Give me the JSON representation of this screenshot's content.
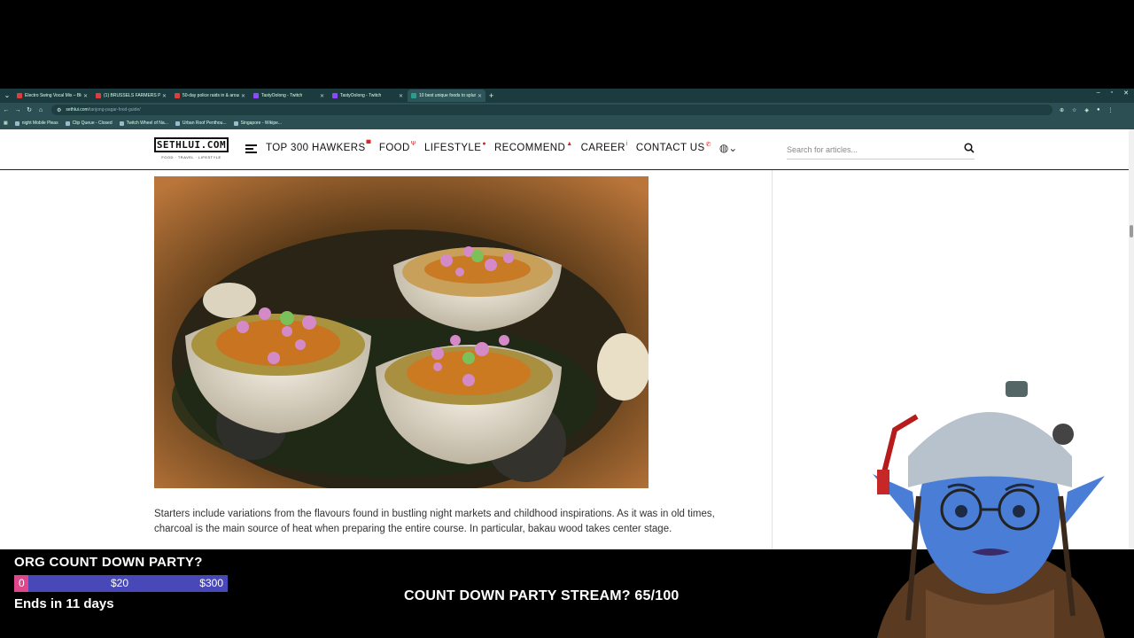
{
  "browser": {
    "tabs": [
      {
        "title": "Electro Swing Vocal Mix – Bloo",
        "fav": "#e23b3b"
      },
      {
        "title": "(1) BRUSSELS FARMERS PROTE",
        "fav": "#e23b3b"
      },
      {
        "title": "50-day police raids in & aroun",
        "fav": "#e23b3b"
      },
      {
        "title": "TastyOolong - Twitch",
        "fav": "#9146ff"
      },
      {
        "title": "TastyOolong - Twitch",
        "fav": "#9146ff"
      },
      {
        "title": "10 best unique foods to splurg",
        "fav": "#2a9d8f"
      }
    ],
    "url_host": "sethlui.com",
    "url_path": "/tanjong-pagar-food-guide/",
    "bookmarks": [
      "night Mobile Pleas",
      "Clip Queue - Closed",
      "Twitch Wheel of Na...",
      "Urban Roof Penthou...",
      "Singapore - Wikipe..."
    ]
  },
  "site": {
    "logo_text": "SETHLUI.COM",
    "logo_tagline": "FOOD · TRAVEL · LIFESTYLE",
    "menu": [
      {
        "label": "TOP 300 HAWKERS",
        "emoji": "▀"
      },
      {
        "label": "FOOD",
        "emoji": "Ψ"
      },
      {
        "label": "LIFESTYLE",
        "emoji": "●"
      },
      {
        "label": "RECOMMEND",
        "emoji": "▲"
      },
      {
        "label": "CAREER",
        "emoji": "i"
      },
      {
        "label": "CONTACT US",
        "emoji": "✆"
      }
    ],
    "search_placeholder": "Search for articles...",
    "article_paragraph": "Starters include variations from the flavours found in bustling night markets and childhood inspirations. As it was in old times, charcoal is the main source of heat when preparing the entire course. In particular, bakau wood takes center stage."
  },
  "overlay": {
    "goal_title": "ORG COUNT DOWN PARTY?",
    "goal_min": "0",
    "goal_current": "$20",
    "goal_max": "$300",
    "goal_progress": 0.067,
    "goal_ends": "Ends in 11 days",
    "stream_goal": "COUNT DOWN PARTY STREAM? 65/100"
  }
}
